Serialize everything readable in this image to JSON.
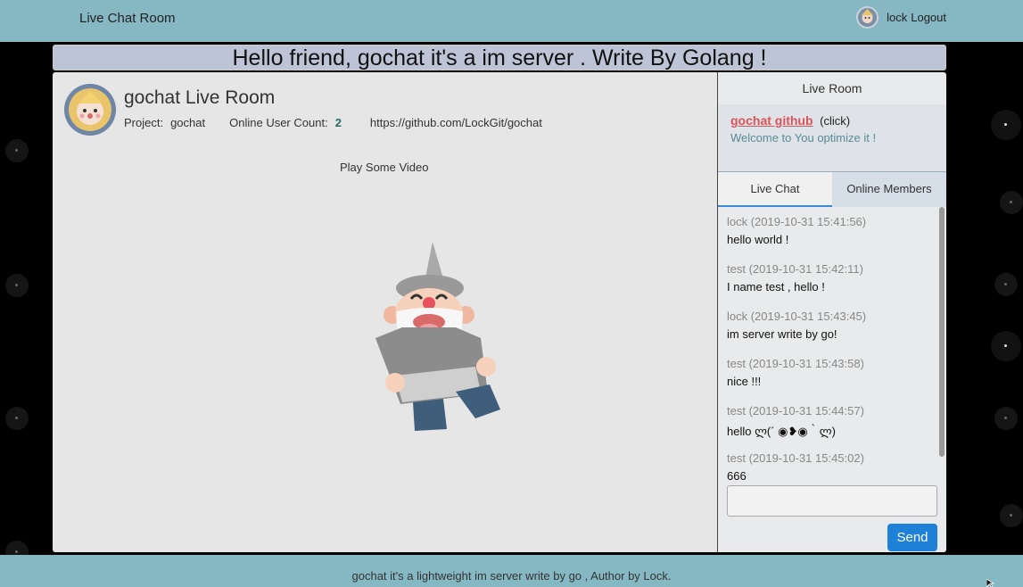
{
  "topbar": {
    "brand": "Live Chat Room",
    "username": "lock",
    "logout_label": "Logout"
  },
  "banner": {
    "text": "Hello friend, gochat it's a im server . Write By Golang !"
  },
  "room": {
    "title": "gochat Live Room",
    "project_label": "Project:",
    "project_value": "gochat",
    "online_label": "Online User Count:",
    "online_count": "2",
    "repo_url": "https://github.com/LockGit/gochat",
    "video_label": "Play Some Video"
  },
  "side": {
    "title": "Live Room",
    "github_link": "gochat github",
    "github_click": "(click)",
    "welcome": "Welcome to You optimize it !",
    "tabs": [
      {
        "label": "Live Chat",
        "active": true
      },
      {
        "label": "Online Members",
        "active": false
      }
    ],
    "messages": [
      {
        "head": "lock (2019-10-31 15:41:56)",
        "body": "hello world !"
      },
      {
        "head": "test (2019-10-31 15:42:11)",
        "body": "I name test , hello !"
      },
      {
        "head": "lock (2019-10-31 15:43:45)",
        "body": "im server write by go!"
      },
      {
        "head": "test (2019-10-31 15:43:58)",
        "body": "nice !!!"
      },
      {
        "head": "test (2019-10-31 15:44:57)",
        "body": "hello ლ(´ ◉❥◉｀ლ)"
      },
      {
        "head": "test (2019-10-31 15:45:02)",
        "body": "666"
      }
    ],
    "input_value": "",
    "send_label": "Send"
  },
  "footer": {
    "text": "gochat it's a lightweight im server write by go , Author by Lock."
  },
  "colors": {
    "bar": "#86b8c3",
    "accent": "#1e80d6",
    "link": "#d9555a"
  }
}
